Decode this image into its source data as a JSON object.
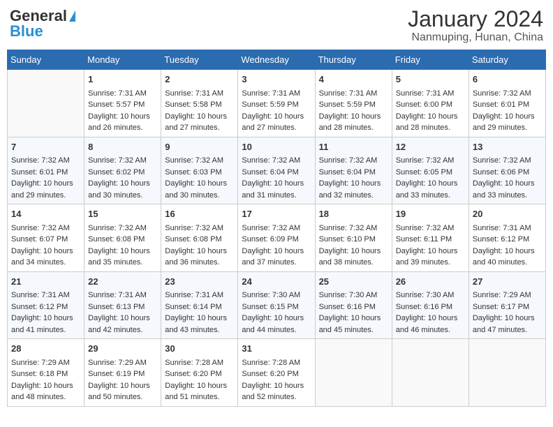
{
  "header": {
    "logo_general": "General",
    "logo_blue": "Blue",
    "title": "January 2024",
    "subtitle": "Nanmuping, Hunan, China"
  },
  "weekdays": [
    "Sunday",
    "Monday",
    "Tuesday",
    "Wednesday",
    "Thursday",
    "Friday",
    "Saturday"
  ],
  "weeks": [
    [
      {
        "day": "",
        "sunrise": "",
        "sunset": "",
        "daylight": ""
      },
      {
        "day": "1",
        "sunrise": "Sunrise: 7:31 AM",
        "sunset": "Sunset: 5:57 PM",
        "daylight": "Daylight: 10 hours and 26 minutes."
      },
      {
        "day": "2",
        "sunrise": "Sunrise: 7:31 AM",
        "sunset": "Sunset: 5:58 PM",
        "daylight": "Daylight: 10 hours and 27 minutes."
      },
      {
        "day": "3",
        "sunrise": "Sunrise: 7:31 AM",
        "sunset": "Sunset: 5:59 PM",
        "daylight": "Daylight: 10 hours and 27 minutes."
      },
      {
        "day": "4",
        "sunrise": "Sunrise: 7:31 AM",
        "sunset": "Sunset: 5:59 PM",
        "daylight": "Daylight: 10 hours and 28 minutes."
      },
      {
        "day": "5",
        "sunrise": "Sunrise: 7:31 AM",
        "sunset": "Sunset: 6:00 PM",
        "daylight": "Daylight: 10 hours and 28 minutes."
      },
      {
        "day": "6",
        "sunrise": "Sunrise: 7:32 AM",
        "sunset": "Sunset: 6:01 PM",
        "daylight": "Daylight: 10 hours and 29 minutes."
      }
    ],
    [
      {
        "day": "7",
        "sunrise": "Sunrise: 7:32 AM",
        "sunset": "Sunset: 6:01 PM",
        "daylight": "Daylight: 10 hours and 29 minutes."
      },
      {
        "day": "8",
        "sunrise": "Sunrise: 7:32 AM",
        "sunset": "Sunset: 6:02 PM",
        "daylight": "Daylight: 10 hours and 30 minutes."
      },
      {
        "day": "9",
        "sunrise": "Sunrise: 7:32 AM",
        "sunset": "Sunset: 6:03 PM",
        "daylight": "Daylight: 10 hours and 30 minutes."
      },
      {
        "day": "10",
        "sunrise": "Sunrise: 7:32 AM",
        "sunset": "Sunset: 6:04 PM",
        "daylight": "Daylight: 10 hours and 31 minutes."
      },
      {
        "day": "11",
        "sunrise": "Sunrise: 7:32 AM",
        "sunset": "Sunset: 6:04 PM",
        "daylight": "Daylight: 10 hours and 32 minutes."
      },
      {
        "day": "12",
        "sunrise": "Sunrise: 7:32 AM",
        "sunset": "Sunset: 6:05 PM",
        "daylight": "Daylight: 10 hours and 33 minutes."
      },
      {
        "day": "13",
        "sunrise": "Sunrise: 7:32 AM",
        "sunset": "Sunset: 6:06 PM",
        "daylight": "Daylight: 10 hours and 33 minutes."
      }
    ],
    [
      {
        "day": "14",
        "sunrise": "Sunrise: 7:32 AM",
        "sunset": "Sunset: 6:07 PM",
        "daylight": "Daylight: 10 hours and 34 minutes."
      },
      {
        "day": "15",
        "sunrise": "Sunrise: 7:32 AM",
        "sunset": "Sunset: 6:08 PM",
        "daylight": "Daylight: 10 hours and 35 minutes."
      },
      {
        "day": "16",
        "sunrise": "Sunrise: 7:32 AM",
        "sunset": "Sunset: 6:08 PM",
        "daylight": "Daylight: 10 hours and 36 minutes."
      },
      {
        "day": "17",
        "sunrise": "Sunrise: 7:32 AM",
        "sunset": "Sunset: 6:09 PM",
        "daylight": "Daylight: 10 hours and 37 minutes."
      },
      {
        "day": "18",
        "sunrise": "Sunrise: 7:32 AM",
        "sunset": "Sunset: 6:10 PM",
        "daylight": "Daylight: 10 hours and 38 minutes."
      },
      {
        "day": "19",
        "sunrise": "Sunrise: 7:32 AM",
        "sunset": "Sunset: 6:11 PM",
        "daylight": "Daylight: 10 hours and 39 minutes."
      },
      {
        "day": "20",
        "sunrise": "Sunrise: 7:31 AM",
        "sunset": "Sunset: 6:12 PM",
        "daylight": "Daylight: 10 hours and 40 minutes."
      }
    ],
    [
      {
        "day": "21",
        "sunrise": "Sunrise: 7:31 AM",
        "sunset": "Sunset: 6:12 PM",
        "daylight": "Daylight: 10 hours and 41 minutes."
      },
      {
        "day": "22",
        "sunrise": "Sunrise: 7:31 AM",
        "sunset": "Sunset: 6:13 PM",
        "daylight": "Daylight: 10 hours and 42 minutes."
      },
      {
        "day": "23",
        "sunrise": "Sunrise: 7:31 AM",
        "sunset": "Sunset: 6:14 PM",
        "daylight": "Daylight: 10 hours and 43 minutes."
      },
      {
        "day": "24",
        "sunrise": "Sunrise: 7:30 AM",
        "sunset": "Sunset: 6:15 PM",
        "daylight": "Daylight: 10 hours and 44 minutes."
      },
      {
        "day": "25",
        "sunrise": "Sunrise: 7:30 AM",
        "sunset": "Sunset: 6:16 PM",
        "daylight": "Daylight: 10 hours and 45 minutes."
      },
      {
        "day": "26",
        "sunrise": "Sunrise: 7:30 AM",
        "sunset": "Sunset: 6:16 PM",
        "daylight": "Daylight: 10 hours and 46 minutes."
      },
      {
        "day": "27",
        "sunrise": "Sunrise: 7:29 AM",
        "sunset": "Sunset: 6:17 PM",
        "daylight": "Daylight: 10 hours and 47 minutes."
      }
    ],
    [
      {
        "day": "28",
        "sunrise": "Sunrise: 7:29 AM",
        "sunset": "Sunset: 6:18 PM",
        "daylight": "Daylight: 10 hours and 48 minutes."
      },
      {
        "day": "29",
        "sunrise": "Sunrise: 7:29 AM",
        "sunset": "Sunset: 6:19 PM",
        "daylight": "Daylight: 10 hours and 50 minutes."
      },
      {
        "day": "30",
        "sunrise": "Sunrise: 7:28 AM",
        "sunset": "Sunset: 6:20 PM",
        "daylight": "Daylight: 10 hours and 51 minutes."
      },
      {
        "day": "31",
        "sunrise": "Sunrise: 7:28 AM",
        "sunset": "Sunset: 6:20 PM",
        "daylight": "Daylight: 10 hours and 52 minutes."
      },
      {
        "day": "",
        "sunrise": "",
        "sunset": "",
        "daylight": ""
      },
      {
        "day": "",
        "sunrise": "",
        "sunset": "",
        "daylight": ""
      },
      {
        "day": "",
        "sunrise": "",
        "sunset": "",
        "daylight": ""
      }
    ]
  ]
}
